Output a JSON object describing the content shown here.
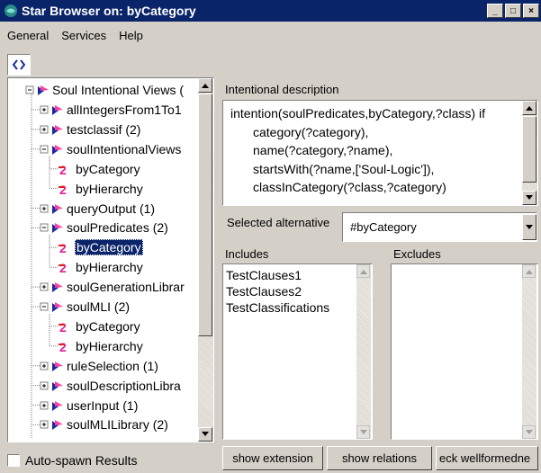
{
  "window": {
    "title": "Star Browser on: byCategory"
  },
  "menu": [
    "General",
    "Services",
    "Help"
  ],
  "nav": {
    "label": "‹ ›"
  },
  "tree": {
    "root": "Soul Intentional Views (",
    "items": [
      {
        "label": "allIntegersFrom1To1",
        "type": "folder"
      },
      {
        "label": "testclassif (2)",
        "type": "folder"
      },
      {
        "label": "soulIntentionalViews",
        "type": "folder"
      },
      {
        "label": "byCategory",
        "type": "leaf"
      },
      {
        "label": "byHierarchy",
        "type": "leaf"
      },
      {
        "label": "queryOutput (1)",
        "type": "folder"
      },
      {
        "label": "soulPredicates (2)",
        "type": "folder"
      },
      {
        "label": "byCategory",
        "type": "leaf",
        "selected": true
      },
      {
        "label": "byHierarchy",
        "type": "leaf"
      },
      {
        "label": "soulGenerationLibrar",
        "type": "folder"
      },
      {
        "label": "soulMLI (2)",
        "type": "folder"
      },
      {
        "label": "byCategory",
        "type": "leaf"
      },
      {
        "label": "byHierarchy",
        "type": "leaf"
      },
      {
        "label": "ruleSelection (1)",
        "type": "folder"
      },
      {
        "label": "soulDescriptionLibra",
        "type": "folder"
      },
      {
        "label": "userInput (1)",
        "type": "folder"
      },
      {
        "label": "soulMLILibrary (2)",
        "type": "folder"
      }
    ]
  },
  "autospawn": {
    "label": "Auto-spawn Results",
    "checked": false
  },
  "intentional": {
    "label": "Intentional description",
    "lines": [
      "intention(soulPredicates,byCategory,?class) if",
      "category(?category),",
      "name(?category,?name),",
      "startsWith(?name,['Soul-Logic']),",
      "classInCategory(?class,?category)"
    ]
  },
  "alternative": {
    "label": "Selected alternative",
    "value": "#byCategory"
  },
  "includes": {
    "label": "Includes",
    "items": [
      "TestClauses1",
      "TestClauses2",
      "TestClassifications"
    ]
  },
  "excludes": {
    "label": "Excludes",
    "items": []
  },
  "buttons": {
    "extension": "show extension",
    "relations": "show relations",
    "wellformed": "eck wellformedne"
  },
  "colors": {
    "titlebar": "#0a246a",
    "selection": "#0a246a",
    "face": "#d4d0c8"
  }
}
